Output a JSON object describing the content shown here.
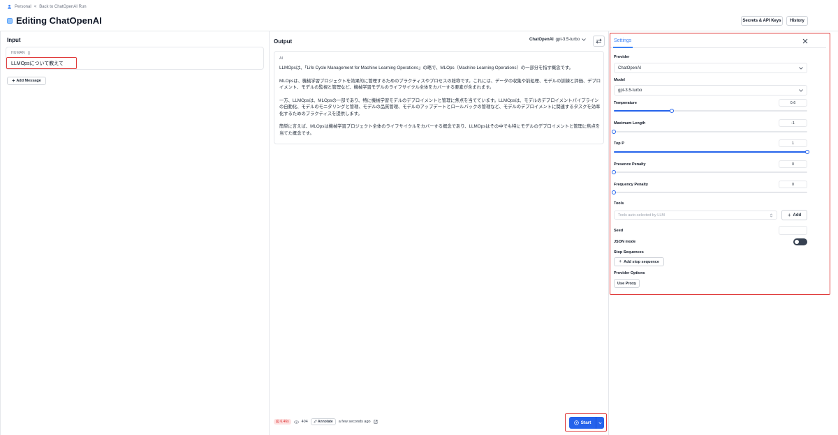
{
  "breadcrumb": {
    "workspace": "Personal",
    "separator": "<",
    "back_link": "Back to ChatOpenAI Run"
  },
  "header": {
    "title": "Editing ChatOpenAI",
    "secrets_button": "Secrets & API Keys",
    "history_button": "History"
  },
  "input": {
    "section_title": "Input",
    "message": {
      "role": "HUMAN",
      "text": "LLMOpsについて教えて"
    },
    "add_message_label": "Add Message"
  },
  "output": {
    "section_title": "Output",
    "provider_label": "ChatOpenAI",
    "model_label": "gpt-3.5-turbo",
    "role": "AI",
    "paragraphs": [
      "LLMOpsは、「Life Cycle Management for Machine Learning Operations」の略で、MLOps（Machine Learning Operations）の一部分を指す概念です。",
      "MLOpsは、機械学習プロジェクトを効果的に管理するためのプラクティスやプロセスの総称です。これには、データの収集や前処理、モデルの訓練と評価、デプロイメント、モデルの監視と管理など、機械学習モデルのライフサイクル全体をカバーする要素が含まれます。",
      "一方、LLMOpsは、MLOpsの一部であり、特に機械学習モデルのデプロイメントと管理に焦点を当てています。LLMOpsは、モデルのデプロイメントパイプラインの自動化、モデルのモニタリングと管理、モデルの品質管理、モデルのアップデートとロールバックの管理など、モデルのデプロイメントに関連するタスクを効率化するためのプラクティスを提供します。",
      "簡単に言えば、MLOpsは機械学習プロジェクト全体のライフサイクルをカバーする概念であり、LLMOpsはその中でも特にモデルのデプロイメントと管理に焦点を当てた概念です。"
    ],
    "footer": {
      "latency": "6.46s",
      "tokens": "404",
      "annotate_label": "Annotate",
      "timestamp": "a few seconds ago"
    },
    "start_label": "Start"
  },
  "settings": {
    "tab_label": "Settings",
    "provider": {
      "label": "Provider",
      "value": "ChatOpenAI"
    },
    "model": {
      "label": "Model",
      "value": "gpt-3.5-turbo"
    },
    "temperature": {
      "label": "Temperature",
      "value": "0.6",
      "level": 0.3
    },
    "max_length": {
      "label": "Maximum Length",
      "value": "-1",
      "level": 0
    },
    "top_p": {
      "label": "Top P",
      "value": "1",
      "level": 1
    },
    "presence_penalty": {
      "label": "Presence Penalty",
      "value": "0",
      "level": 0
    },
    "frequency_penalty": {
      "label": "Frequency Penalty",
      "value": "0",
      "level": 0
    },
    "tools": {
      "label": "Tools",
      "placeholder": "Tools auto-selected by LLM",
      "add_label": "Add"
    },
    "seed": {
      "label": "Seed",
      "value": ""
    },
    "json_mode": {
      "label": "JSON mode",
      "on": false
    },
    "stop_sequences": {
      "label": "Stop Sequences",
      "add_label": "Add stop sequence"
    },
    "provider_options": {
      "label": "Provider Options",
      "proxy_label": "Use Proxy"
    }
  },
  "colors": {
    "accent": "#2563eb",
    "highlight": "#e03b3b",
    "border": "#e5e7eb"
  }
}
